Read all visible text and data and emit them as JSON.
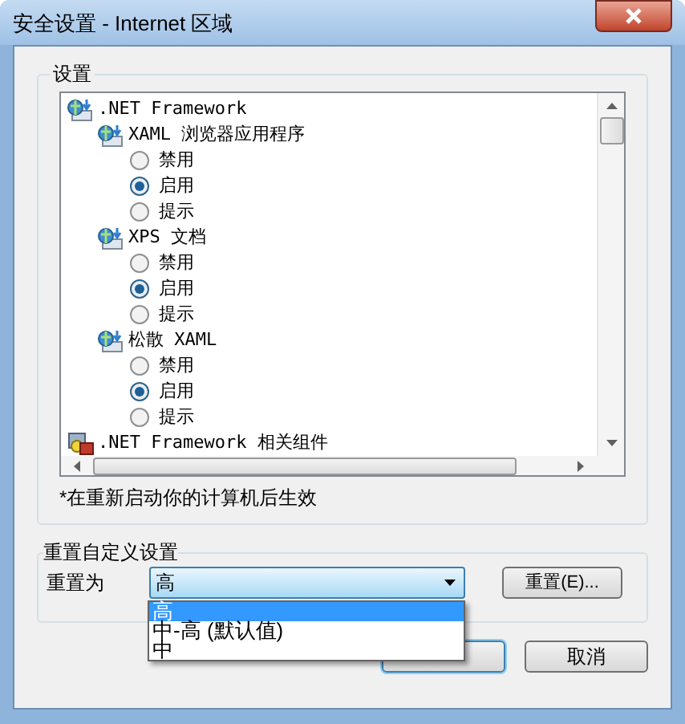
{
  "window": {
    "title": "安全设置 - Internet 区域"
  },
  "settings_group": {
    "label": "设置",
    "tree": [
      {
        "label": ".NET Framework",
        "kind": "net",
        "children": [
          {
            "label": "XAML 浏览器应用程序",
            "kind": "net",
            "options": [
              {
                "label": "禁用",
                "selected": false
              },
              {
                "label": "启用",
                "selected": true
              },
              {
                "label": "提示",
                "selected": false
              }
            ]
          },
          {
            "label": "XPS 文档",
            "kind": "net",
            "options": [
              {
                "label": "禁用",
                "selected": false
              },
              {
                "label": "启用",
                "selected": true
              },
              {
                "label": "提示",
                "selected": false
              }
            ]
          },
          {
            "label": "松散 XAML",
            "kind": "net",
            "options": [
              {
                "label": "禁用",
                "selected": false
              },
              {
                "label": "启用",
                "selected": true
              },
              {
                "label": "提示",
                "selected": false
              }
            ]
          }
        ]
      },
      {
        "label": ".NET Framework 相关组件",
        "kind": "components"
      }
    ],
    "note": "*在重新启动你的计算机后生效"
  },
  "reset_group": {
    "label": "重置自定义设置",
    "reset_to_label": "重置为",
    "combo": {
      "value": "高",
      "expanded": true,
      "options": [
        {
          "label": "高",
          "selected": true
        },
        {
          "label": "中-高 (默认值)",
          "selected": false
        },
        {
          "label": "中",
          "selected": false
        }
      ]
    },
    "reset_button": "重置(E)..."
  },
  "buttons": [
    {
      "default": true
    },
    {
      "label": "取消",
      "default": false
    }
  ]
}
